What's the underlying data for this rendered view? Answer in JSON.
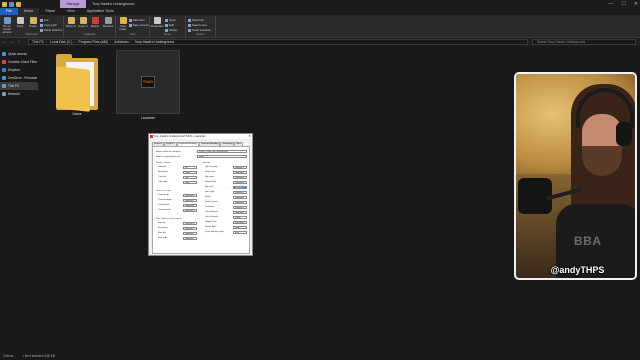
{
  "window": {
    "title": "Tony Hawk's Underground",
    "context_tab": "Manage",
    "controls": [
      "—",
      "☐",
      "✕"
    ]
  },
  "tabs": [
    "File",
    "Home",
    "Share",
    "View",
    "Application Tools"
  ],
  "ribbon": {
    "groups": {
      "clipboard": "Clipboard",
      "organize": "Organize",
      "new": "New",
      "open": "Open",
      "select": "Select"
    },
    "buttons": {
      "pin": "Pin to Quick access",
      "copy": "Copy",
      "paste": "Paste",
      "cut": "Cut",
      "copy_path": "Copy path",
      "paste_shortcut": "Paste shortcut",
      "move_to": "Move to",
      "copy_to": "Copy to",
      "delete": "Delete",
      "rename": "Rename",
      "new_folder": "New folder",
      "new_item": "New item",
      "easy_access": "Easy access",
      "properties": "Properties",
      "open": "Open",
      "edit": "Edit",
      "history": "History",
      "select_all": "Select all",
      "select_none": "Select none",
      "invert_selection": "Invert selection"
    }
  },
  "address": {
    "crumbs": [
      "This PC",
      "Local Disk (C:)",
      "Program Files (x86)",
      "Activision",
      "Tony Hawk's Underground"
    ],
    "search_placeholder": "Search Tony Hawk's Underground"
  },
  "nav": {
    "items": [
      {
        "label": "Quick access",
        "color": "#4a8ad8"
      },
      {
        "label": "Creative Cloud Files",
        "color": "#d84a3a"
      },
      {
        "label": "Dropbox",
        "color": "#3a7bd5"
      },
      {
        "label": "OneDrive - Personal",
        "color": "#3a9ad5"
      },
      {
        "label": "This PC",
        "color": "#5aa0e0"
      },
      {
        "label": "Network",
        "color": "#7aa0c0"
      }
    ]
  },
  "files": [
    {
      "name": "Game",
      "type": "folder"
    },
    {
      "name": "Launcher",
      "type": "exe",
      "icon_text": "THUG"
    }
  ],
  "status": {
    "count": "2 items",
    "selected": "1 item selected  348 KB"
  },
  "dialog": {
    "title": "Tony Hawk's Underground THUG - Launcher",
    "tabs": [
      "General",
      "Graphics",
      "Keyboard Bindings",
      "Gamepad Binding",
      "Gameplay",
      "Misc"
    ],
    "active_tab": "Keyboard Bindings",
    "top_fields": [
      {
        "label": "Select player to configure",
        "value": "Player 1 (and Pad Configuration)"
      },
      {
        "label": "Select a gamepad to use",
        "value": "None"
      }
    ],
    "left_groups": [
      {
        "title": "Skater controls",
        "rows": [
          {
            "label": "Forward",
            "value": "Up"
          },
          {
            "label": "Backward",
            "value": "Down"
          },
          {
            "label": "Turn left",
            "value": "Left"
          },
          {
            "label": "Turn right",
            "value": "Right"
          }
        ]
      },
      {
        "title": "Camera control",
        "rows": [
          {
            "label": "Camera up",
            "value": "Numpad 8"
          },
          {
            "label": "Camera down",
            "value": "Numpad 2"
          },
          {
            "label": "Camera left",
            "value": "Numpad 4"
          },
          {
            "label": "Camera right",
            "value": "Numpad 6"
          }
        ]
      },
      {
        "title": "Park editor camera control",
        "rows": [
          {
            "label": "Item up",
            "value": "Numpad 9"
          },
          {
            "label": "Item down",
            "value": "Numpad 3"
          },
          {
            "label": "Item left",
            "value": "Numpad 7"
          },
          {
            "label": "Item right",
            "value": "Numpad 1"
          }
        ]
      }
    ],
    "right_group": {
      "title": "Actions",
      "rows": [
        {
          "label": "Ollie or jump",
          "value": "Numpad 5"
        },
        {
          "label": "Grab tricks",
          "value": "Numpad 6"
        },
        {
          "label": "Flip tricks",
          "value": "Numpad 4"
        },
        {
          "label": "Grind tricks",
          "value": "Numpad 8"
        },
        {
          "label": "Spin left",
          "value": "Numpad 7",
          "highlight": true
        },
        {
          "label": "Spin right",
          "value": "Numpad 9"
        },
        {
          "label": "Nollie",
          "value": "Numpad 1"
        },
        {
          "label": "Switch revert",
          "value": "Numpad 3"
        },
        {
          "label": "Caveman",
          "value": "Numpad 0"
        },
        {
          "label": "Get off board",
          "value": "Numpad 2"
        },
        {
          "label": "Get off board",
          "value": "Delete"
        },
        {
          "label": "Toggle view",
          "value": "Backspace"
        },
        {
          "label": "Skater Bail",
          "value": "Space"
        },
        {
          "label": "Quick balance right",
          "value": "End"
        }
      ]
    }
  },
  "webcam": {
    "handle": "@andyTHPS",
    "shirt_text": "BBA"
  }
}
